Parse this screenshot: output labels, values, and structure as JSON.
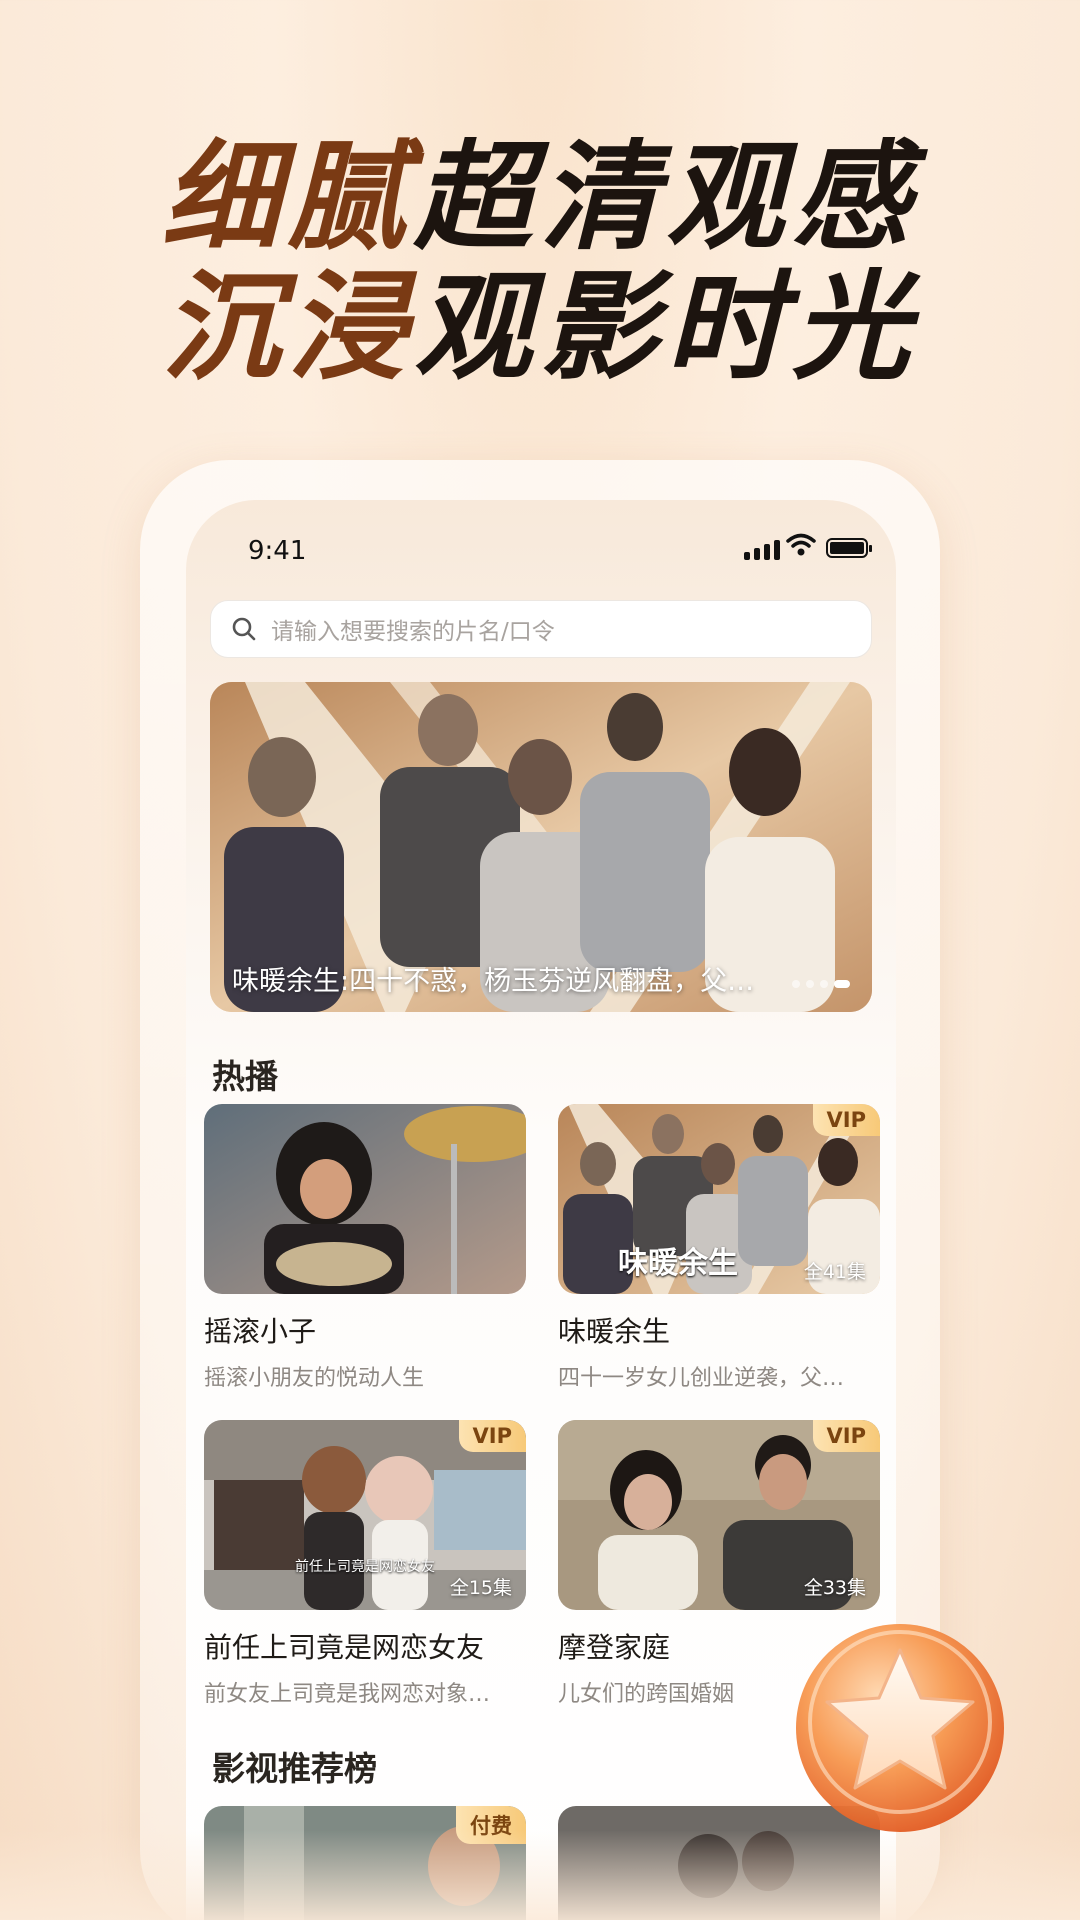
{
  "promo": {
    "headline_line1_accent": "细腻",
    "headline_line1_rest": "超清观感",
    "headline_line2_accent": "沉浸",
    "headline_line2_rest": "观影时光"
  },
  "status_bar": {
    "time": "9:41"
  },
  "search": {
    "placeholder": "请输入想要搜索的片名/口令"
  },
  "banner": {
    "caption": "味暖余生:四十不惑，杨玉芬逆风翻盘，父…",
    "page_count": 4,
    "active_index": 3
  },
  "hot_section": {
    "title": "热播"
  },
  "cards": [
    {
      "title": "摇滚小子",
      "subtitle": "摇滚小朋友的悦动人生",
      "badge": "",
      "episodes": ""
    },
    {
      "title": "味暖余生",
      "subtitle": "四十一岁女儿创业逆袭，父…",
      "badge": "VIP",
      "episodes": "全41集",
      "poster_text": "味暖余生"
    },
    {
      "title": "前任上司竟是网恋女友",
      "subtitle": "前女友上司竟是我网恋对象…",
      "badge": "VIP",
      "episodes": "全15集",
      "poster_text": "前任上司竟是网恋女友"
    },
    {
      "title": "摩登家庭",
      "subtitle": "儿女们的跨国婚姻",
      "badge": "VIP",
      "episodes": "全33集"
    }
  ],
  "rank_section": {
    "title": "影视推荐榜"
  },
  "rank_cards": [
    {
      "badge": "付费"
    },
    {
      "badge": ""
    }
  ],
  "colors": {
    "accent_brown": "#7a3a14",
    "vip_gold": "#f7c978",
    "bg_peach": "#fdeedf"
  }
}
